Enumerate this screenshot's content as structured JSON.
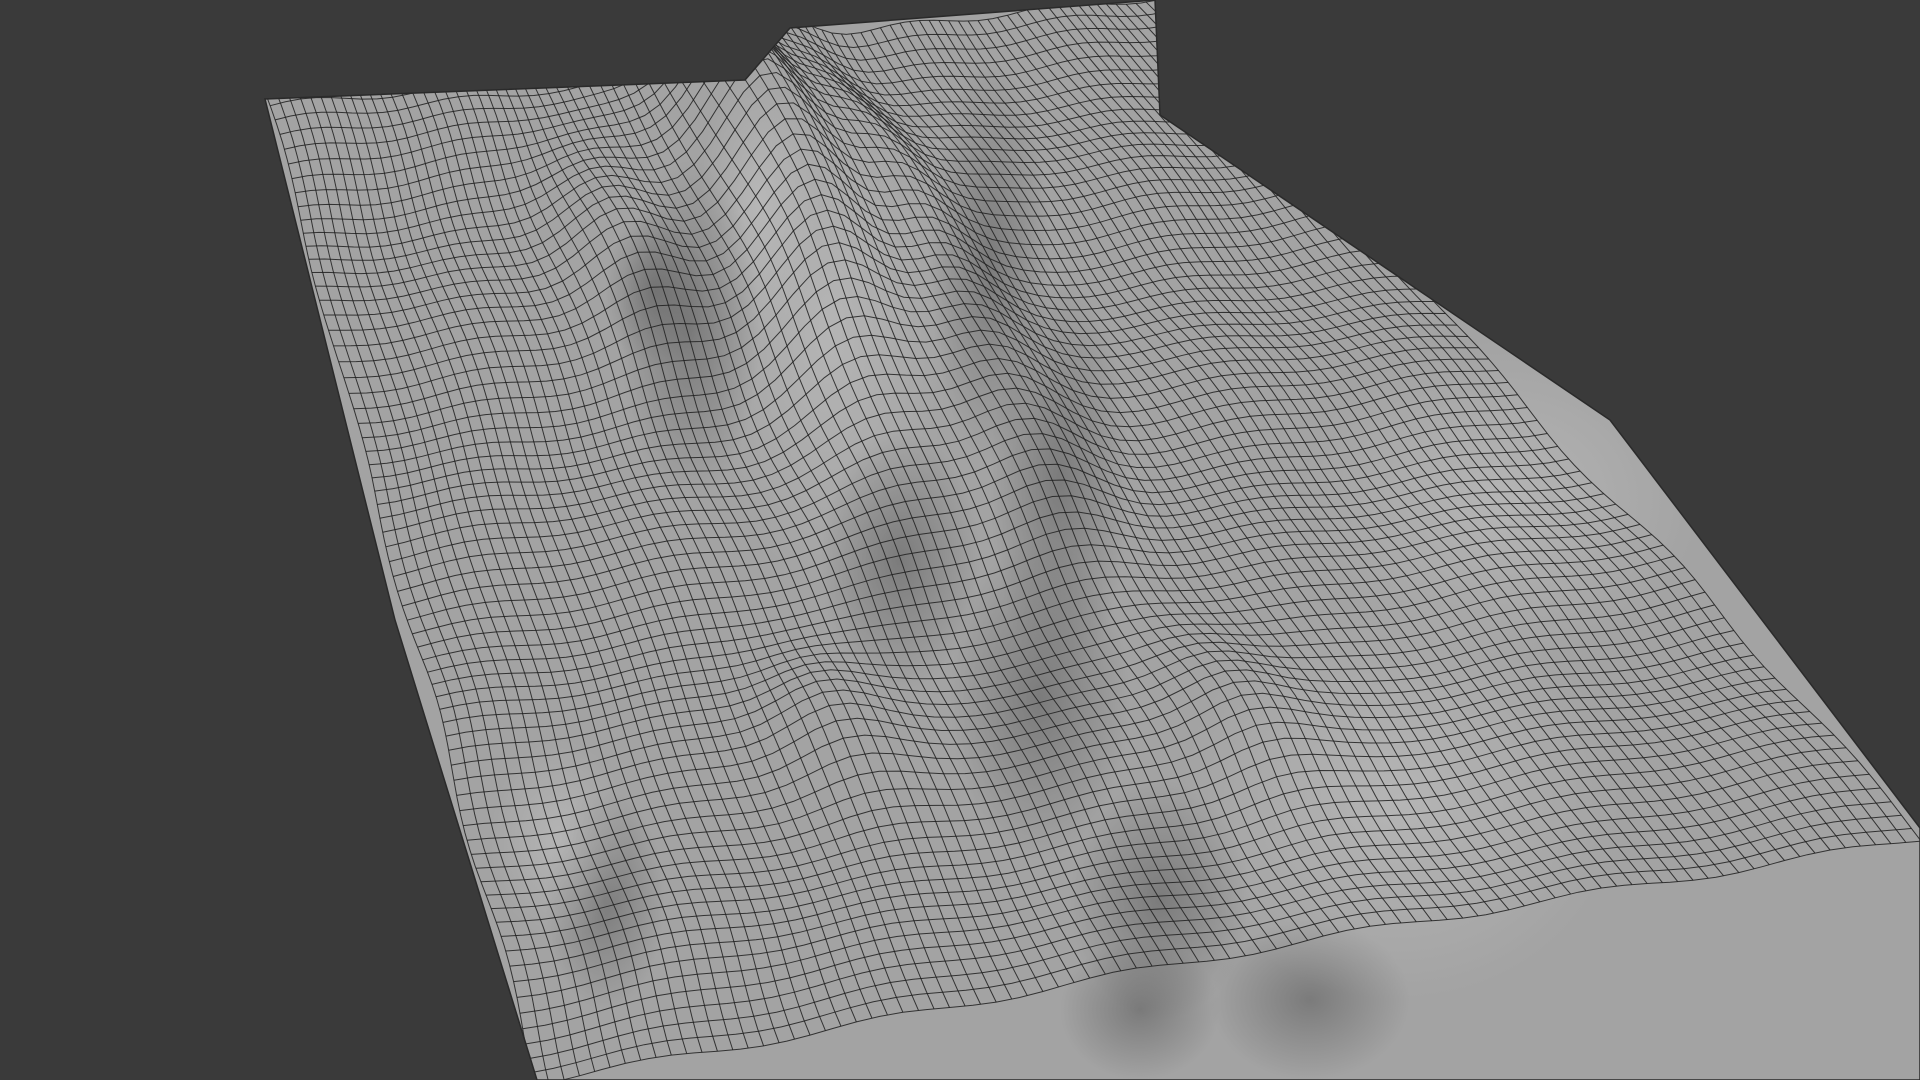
{
  "viewport": {
    "background_color": "#3a3a3a",
    "mesh_fill_color": "#a3a3a3",
    "mesh_wire_color": "#1e1e1e",
    "shading": "solid",
    "overlay": "wireframe",
    "object_description_icon": "terrain-mesh-icon"
  }
}
